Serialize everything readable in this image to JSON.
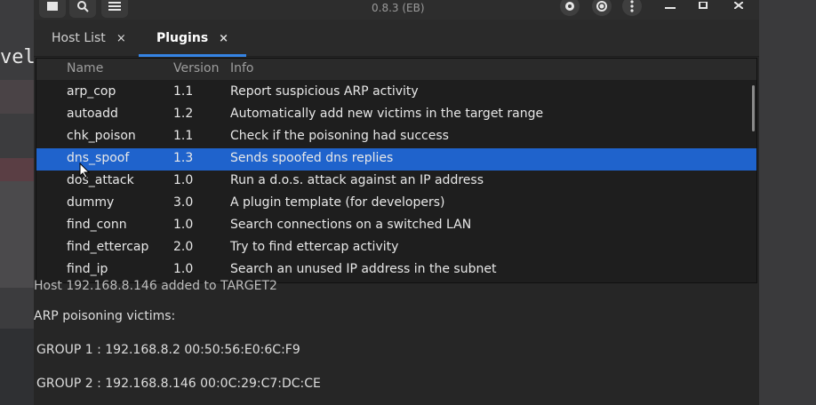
{
  "background": {
    "partial_text": "vel"
  },
  "window": {
    "version": "0.8.3 (EB)",
    "icons": [
      "menu-icon",
      "search-icon",
      "settings-icon",
      "sniff-icon",
      "record-icon",
      "kebab-icon",
      "minimize-icon",
      "maximize-icon",
      "close-icon"
    ]
  },
  "tabs": [
    {
      "label": "Host List",
      "close": "×",
      "active": false
    },
    {
      "label": "Plugins",
      "close": "×",
      "active": true
    }
  ],
  "plugins": {
    "headers": {
      "name": "Name",
      "version": "Version",
      "info": "Info"
    },
    "rows": [
      {
        "name": "arp_cop",
        "version": "1.1",
        "info": "Report suspicious ARP activity"
      },
      {
        "name": "autoadd",
        "version": "1.2",
        "info": "Automatically add new victims in the target range"
      },
      {
        "name": "chk_poison",
        "version": "1.1",
        "info": "Check if the poisoning had success"
      },
      {
        "name": "dns_spoof",
        "version": "1.3",
        "info": "Sends spoofed dns replies"
      },
      {
        "name": "dos_attack",
        "version": "1.0",
        "info": "Run a d.o.s. attack against an IP address"
      },
      {
        "name": "dummy",
        "version": "3.0",
        "info": "A plugin template (for developers)"
      },
      {
        "name": "find_conn",
        "version": "1.0",
        "info": "Search connections on a switched LAN"
      },
      {
        "name": "find_ettercap",
        "version": "2.0",
        "info": "Try to find ettercap activity"
      },
      {
        "name": "find_ip",
        "version": "1.0",
        "info": "Search an unused IP address in the subnet"
      }
    ],
    "selected_row": 3,
    "colors": {
      "selection": "#1f63cc",
      "tab_accent": "#3584e4"
    }
  },
  "log": {
    "partial_line": "Host 192.168.8.146 added to TARGET2",
    "title": "ARP poisoning victims:",
    "group1": "GROUP 1 : 192.168.8.2 00:50:56:E0:6C:F9",
    "group2": "GROUP 2 : 192.168.8.146 00:0C:29:C7:DC:CE"
  }
}
